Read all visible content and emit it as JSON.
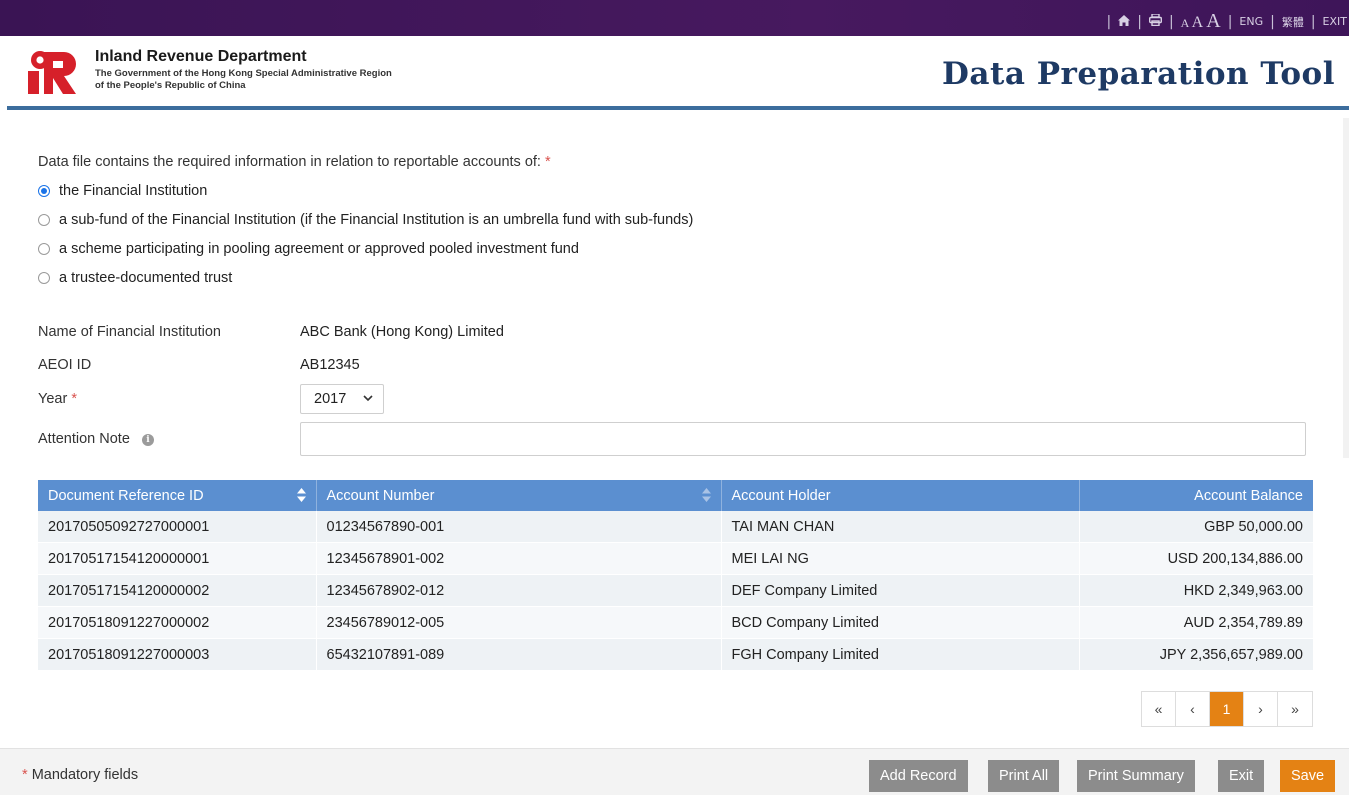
{
  "topbar": {
    "home_icon": "home-icon",
    "print_icon": "print-icon",
    "font_sizes": [
      "A",
      "A",
      "A"
    ],
    "lang_eng": "ENG",
    "lang_tc": "繁體",
    "exit": "EXIT"
  },
  "header": {
    "dept_name": "Inland Revenue Department",
    "dept_sub_1": "The Government of the Hong Kong Special Administrative Region",
    "dept_sub_2": "of the People's Republic of China",
    "app_title": "Data Preparation Tool",
    "colors": {
      "brand_bar": "#3a1454",
      "title": "#1e3a64",
      "rule": "#3c6d9d"
    }
  },
  "form": {
    "question": "Data file contains the required information in relation to reportable accounts of:",
    "required_mark": "*",
    "options": [
      {
        "label": "the Financial Institution",
        "selected": true
      },
      {
        "label": "a sub-fund of the Financial Institution (if the Financial Institution is an umbrella fund with sub-funds)",
        "selected": false
      },
      {
        "label": "a scheme participating in pooling agreement or approved pooled investment fund",
        "selected": false
      },
      {
        "label": "a trustee-documented trust",
        "selected": false
      }
    ],
    "fi_name_label": "Name of Financial Institution",
    "fi_name_value": "ABC Bank (Hong Kong) Limited",
    "aeoi_label": "AEOI ID",
    "aeoi_value": "AB12345",
    "year_label": "Year",
    "year_value": "2017",
    "note_label": "Attention Note",
    "note_value": ""
  },
  "table": {
    "headers": [
      "Document Reference ID",
      "Account Number",
      "Account Holder",
      "Account Balance"
    ],
    "rows": [
      [
        "20170505092727000001",
        "01234567890-001",
        "TAI MAN CHAN",
        "GBP 50,000.00"
      ],
      [
        "20170517154120000001",
        "12345678901-002",
        "MEI LAI NG",
        "USD 200,134,886.00"
      ],
      [
        "20170517154120000002",
        "12345678902-012",
        "DEF Company Limited",
        "HKD 2,349,963.00"
      ],
      [
        "20170518091227000002",
        "23456789012-005",
        "BCD Company Limited",
        "AUD 2,354,789.89"
      ],
      [
        "20170518091227000003",
        "65432107891-089",
        "FGH Company Limited",
        "JPY 2,356,657,989.00"
      ]
    ],
    "header_color": "#5b8fd0"
  },
  "pager": {
    "first": "«",
    "prev": "‹",
    "current": "1",
    "next": "›",
    "last": "»",
    "active_color": "#e48214"
  },
  "footer": {
    "mandatory_mark": "*",
    "mandatory_text": "Mandatory fields",
    "buttons": {
      "add_record": "Add Record",
      "print_all": "Print All",
      "print_summary": "Print Summary",
      "exit": "Exit",
      "save": "Save"
    }
  }
}
